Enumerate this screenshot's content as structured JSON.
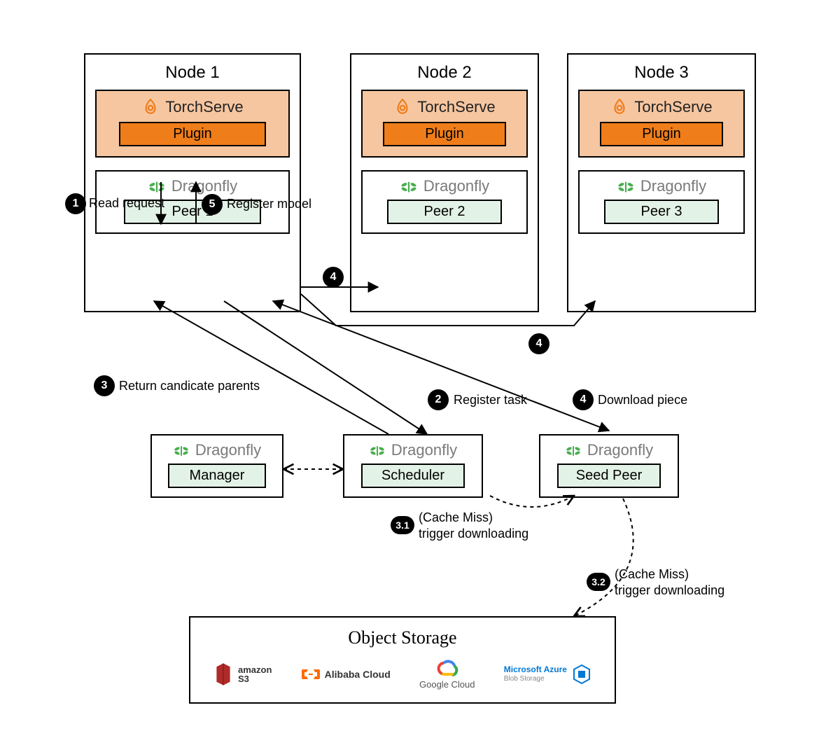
{
  "nodes": [
    {
      "title": "Node 1",
      "torchserve": "TorchServe",
      "plugin": "Plugin",
      "dragonfly": "Dragonfly",
      "peer": "Peer 1"
    },
    {
      "title": "Node 2",
      "torchserve": "TorchServe",
      "plugin": "Plugin",
      "dragonfly": "Dragonfly",
      "peer": "Peer 2"
    },
    {
      "title": "Node 3",
      "torchserve": "TorchServe",
      "plugin": "Plugin",
      "dragonfly": "Dragonfly",
      "peer": "Peer 3"
    }
  ],
  "services": {
    "manager": {
      "brand": "Dragonfly",
      "role": "Manager"
    },
    "scheduler": {
      "brand": "Dragonfly",
      "role": "Scheduler"
    },
    "seedpeer": {
      "brand": "Dragonfly",
      "role": "Seed Peer"
    }
  },
  "storage": {
    "title": "Object Storage",
    "s3": {
      "line1": "amazon",
      "line2": "S3"
    },
    "ali": {
      "text": "Alibaba Cloud"
    },
    "gcp": {
      "text": "Google Cloud"
    },
    "azure": {
      "line1": "Microsoft Azure",
      "line2": "Blob Storage"
    }
  },
  "steps": {
    "s1": {
      "num": "1",
      "text": "Read request"
    },
    "s2": {
      "num": "2",
      "text": "Register task"
    },
    "s3": {
      "num": "3",
      "text": "Return candicate parents"
    },
    "s3_1": {
      "num": "3.1",
      "text": "(Cache Miss)\ntrigger downloading"
    },
    "s3_2": {
      "num": "3.2",
      "text": "(Cache Miss)\ntrigger downloading"
    },
    "s4a": {
      "num": "4"
    },
    "s4b": {
      "num": "4"
    },
    "s4c": {
      "num": "4",
      "text": "Download piece"
    },
    "s5": {
      "num": "5",
      "text": "Register model"
    }
  },
  "colors": {
    "torchserve_orange": "#ef7d1a",
    "torchserve_bg": "#f6c6a0",
    "dragonfly_green": "#4aae4f",
    "peer_bg": "#e3f2e6",
    "azure_blue": "#0078d4",
    "gcp_blue": "#4285f4",
    "gcp_red": "#ea4335",
    "gcp_yellow": "#fbbc05",
    "gcp_green": "#34a853",
    "s3_red": "#b02a2a",
    "ali_orange": "#ff6a00"
  }
}
